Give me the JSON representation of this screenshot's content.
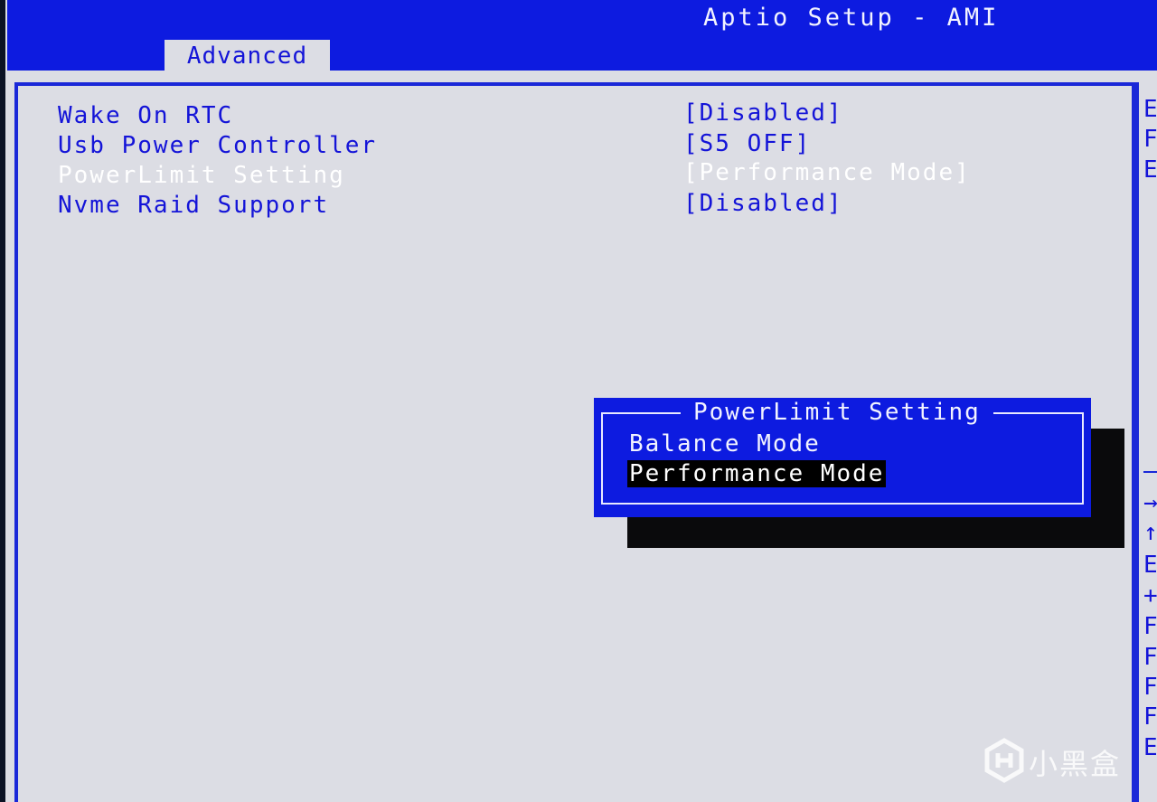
{
  "header": {
    "title": "Aptio Setup - AMI",
    "active_tab": "Advanced"
  },
  "settings": [
    {
      "label": "Wake On RTC",
      "value": "[Disabled]",
      "selected": false
    },
    {
      "label": "Usb Power Controller",
      "value": "[S5 OFF]",
      "selected": false
    },
    {
      "label": "PowerLimit Setting",
      "value": "[Performance Mode]",
      "selected": true
    },
    {
      "label": "Nvme Raid Support",
      "value": "[Disabled]",
      "selected": false
    }
  ],
  "popup": {
    "title": "PowerLimit Setting",
    "options": [
      "Balance Mode",
      "Performance Mode"
    ],
    "highlighted_option": "Performance Mode"
  },
  "help_column_fragments": [
    "E",
    "F",
    "E",
    "→",
    "↑",
    "E",
    "+",
    "F",
    "F",
    "F",
    "F",
    "E"
  ],
  "watermark": {
    "text": "小黑盒"
  },
  "colors": {
    "bios_blue": "#0d1be0",
    "panel_gray": "#dcdde4",
    "text_blue": "#1414d8",
    "highlight_bg": "#000000"
  }
}
